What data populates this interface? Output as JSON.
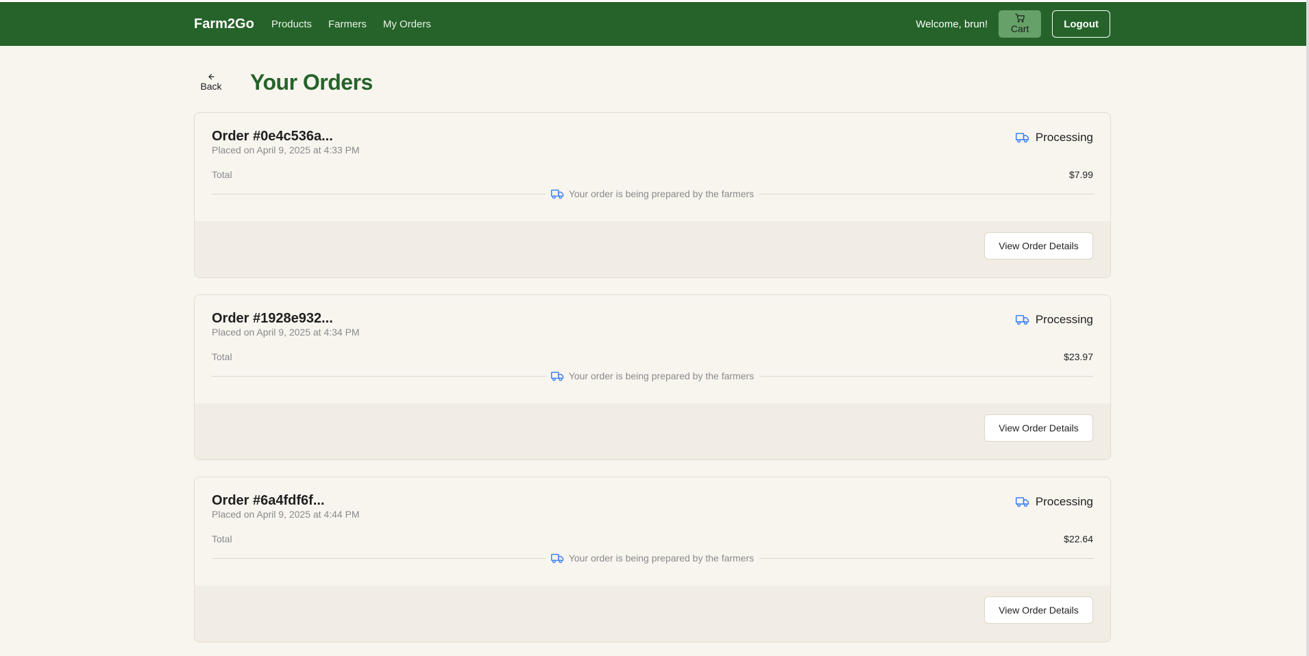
{
  "nav": {
    "brand": "Farm2Go",
    "links": [
      "Products",
      "Farmers",
      "My Orders"
    ],
    "welcome": "Welcome, brun!",
    "cart_label": "Cart",
    "logout_label": "Logout"
  },
  "page": {
    "back_label": "Back",
    "title": "Your Orders"
  },
  "orders": [
    {
      "id_label": "Order #0e4c536a...",
      "date_label": "Placed on April 9, 2025 at 4:33 PM",
      "status": "Processing",
      "total_label": "Total",
      "total_value": "$7.99",
      "note": "Your order is being prepared by the farmers",
      "button_label": "View Order Details"
    },
    {
      "id_label": "Order #1928e932...",
      "date_label": "Placed on April 9, 2025 at 4:34 PM",
      "status": "Processing",
      "total_label": "Total",
      "total_value": "$23.97",
      "note": "Your order is being prepared by the farmers",
      "button_label": "View Order Details"
    },
    {
      "id_label": "Order #6a4fdf6f...",
      "date_label": "Placed on April 9, 2025 at 4:44 PM",
      "status": "Processing",
      "total_label": "Total",
      "total_value": "$22.64",
      "note": "Your order is being prepared by the farmers",
      "button_label": "View Order Details"
    }
  ],
  "colors": {
    "nav_bg": "#25632a",
    "accent_green": "#25632a",
    "status_icon": "#3b82f6",
    "page_bg": "#f8f5ef"
  },
  "icons": {
    "back": "arrow-left-icon",
    "cart": "shopping-cart-icon",
    "status": "truck-icon"
  }
}
